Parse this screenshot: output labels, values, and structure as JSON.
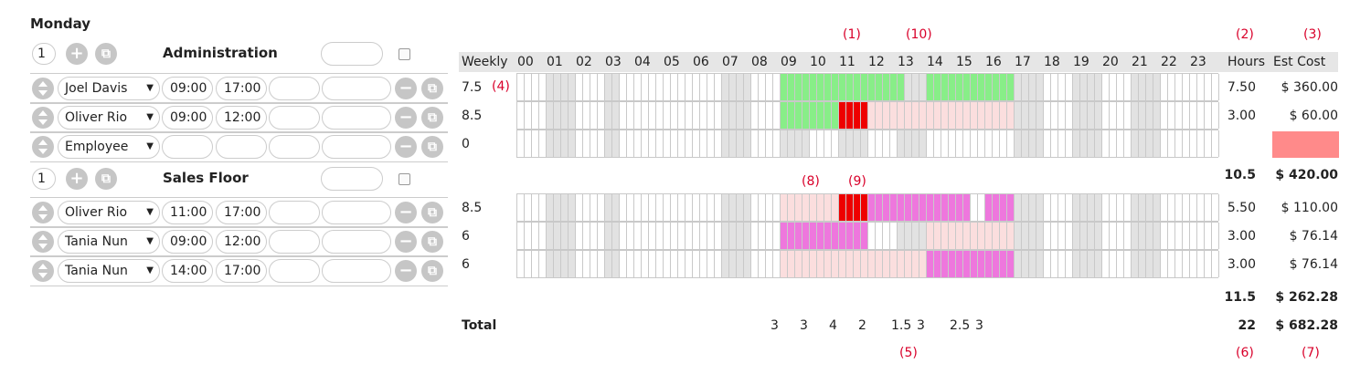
{
  "day": "Monday",
  "sections": [
    {
      "count": "1",
      "title": "Administration",
      "shifts": [
        {
          "employee": "Joel Davis",
          "start": "09:00",
          "end": "17:00",
          "weekly": "7.5",
          "hours": "7.50",
          "cost": "$ 360.00"
        },
        {
          "employee": "Oliver Rio",
          "start": "09:00",
          "end": "12:00",
          "weekly": "8.5",
          "hours": "3.00",
          "cost": "$ 60.00"
        },
        {
          "employee": "Employee",
          "start": "",
          "end": "",
          "weekly": "0",
          "hours": "",
          "cost": ""
        }
      ],
      "total_hours": "10.5",
      "total_cost": "$ 420.00"
    },
    {
      "count": "1",
      "title": "Sales Floor",
      "shifts": [
        {
          "employee": "Oliver Rio",
          "start": "11:00",
          "end": "17:00",
          "weekly": "8.5",
          "hours": "5.50",
          "cost": "$ 110.00"
        },
        {
          "employee": "Tania Nun",
          "start": "09:00",
          "end": "12:00",
          "weekly": "6",
          "hours": "3.00",
          "cost": "$ 76.14"
        },
        {
          "employee": "Tania Nun",
          "start": "14:00",
          "end": "17:00",
          "weekly": "6",
          "hours": "3.00",
          "cost": "$ 76.14"
        }
      ],
      "total_hours": "11.5",
      "total_cost": "$ 262.28"
    }
  ],
  "grid": {
    "weekly_label": "Weekly",
    "hours_label": "Hours",
    "cost_label": "Est Cost",
    "hours": [
      "00",
      "01",
      "02",
      "03",
      "04",
      "05",
      "06",
      "07",
      "08",
      "09",
      "10",
      "11",
      "12",
      "13",
      "14",
      "15",
      "16",
      "17",
      "18",
      "19",
      "20",
      "21",
      "22",
      "23"
    ]
  },
  "totals": {
    "label": "Total",
    "hourly": [
      {
        "hour": 9,
        "value": "3"
      },
      {
        "hour": 10,
        "value": "3"
      },
      {
        "hour": 11,
        "value": "4"
      },
      {
        "hour": 12,
        "value": "2"
      },
      {
        "hour": 13,
        "value": "1.5"
      },
      {
        "hour": 14,
        "value": "3"
      },
      {
        "hour": 15,
        "value": "2.5"
      },
      {
        "hour": 16,
        "value": "3"
      }
    ],
    "hours": "22",
    "cost": "$ 682.28"
  },
  "callouts": [
    "(1)",
    "(2)",
    "(3)",
    "(4)",
    "(5)",
    "(6)",
    "(7)",
    "(8)",
    "(9)",
    "(10)"
  ],
  "colors": {
    "green": "#88ee88",
    "red": "#ee0000",
    "pink": "#fbdede",
    "magenta": "#ee77dd",
    "grey": "#e2e2e2",
    "header": "#e6e6e6",
    "costwarn": "#ff8a8a"
  }
}
